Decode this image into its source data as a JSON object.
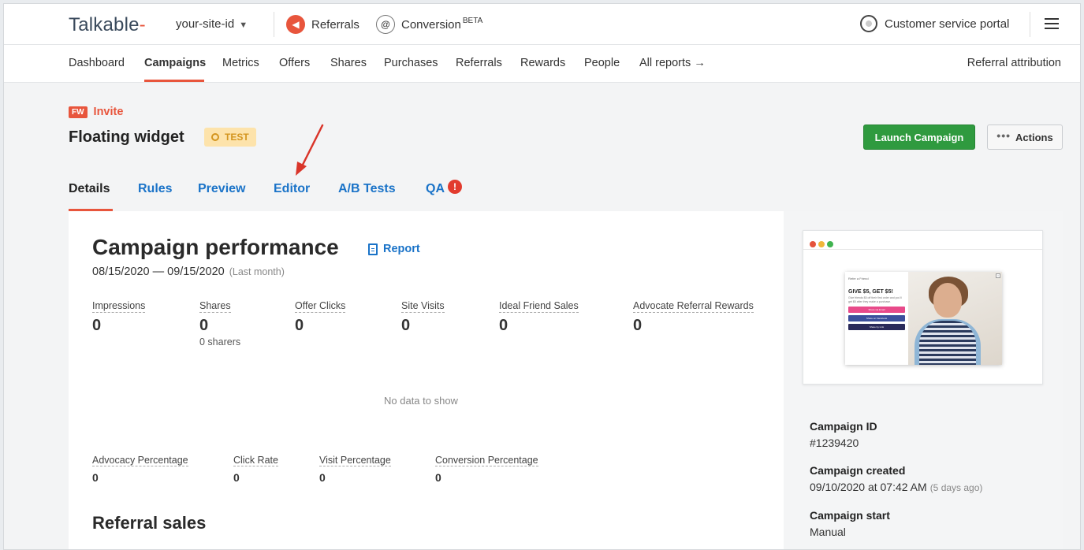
{
  "topbar": {
    "logo": "Talkable",
    "site_id": "your-site-id",
    "products": [
      {
        "label": "Referrals",
        "icon": "megaphone-icon"
      },
      {
        "label": "Conversion",
        "badge": "BETA",
        "icon": "at-sign-icon"
      }
    ],
    "portal": "Customer service portal"
  },
  "nav": {
    "items": [
      "Dashboard",
      "Campaigns",
      "Metrics",
      "Offers",
      "Shares",
      "Purchases",
      "Referrals",
      "Rewards",
      "People",
      "All reports"
    ],
    "active": "Campaigns",
    "right": "Referral attribution"
  },
  "campaign": {
    "type_badge": "FW",
    "type": "Invite",
    "title": "Floating widget",
    "status": "TEST",
    "launch_label": "Launch Campaign",
    "actions_label": "Actions"
  },
  "tabs": {
    "items": [
      "Details",
      "Rules",
      "Preview",
      "Editor",
      "A/B Tests",
      "QA"
    ],
    "active": "Details",
    "qa_alert": "!"
  },
  "performance": {
    "title": "Campaign performance",
    "report_label": "Report",
    "date_range": "08/15/2020 — 09/15/2020",
    "range_label": "(Last month)",
    "metrics": [
      {
        "label": "Impressions",
        "value": "0"
      },
      {
        "label": "Shares",
        "value": "0",
        "sub": "0 sharers"
      },
      {
        "label": "Offer Clicks",
        "value": "0"
      },
      {
        "label": "Site Visits",
        "value": "0"
      },
      {
        "label": "Ideal Friend Sales",
        "value": "0"
      },
      {
        "label": "Advocate Referral Rewards",
        "value": "0"
      }
    ],
    "no_data": "No data to show",
    "rates": [
      {
        "label": "Advocacy Percentage",
        "value": "0"
      },
      {
        "label": "Click Rate",
        "value": "0"
      },
      {
        "label": "Visit Percentage",
        "value": "0"
      },
      {
        "label": "Conversion Percentage",
        "value": "0"
      }
    ],
    "sales_title": "Referral sales"
  },
  "preview_widget": {
    "header": "Refer a Friend",
    "offer": "GIVE $5, GET $5!",
    "desc": "Give friends $5 off their first order and you'll get $5 after they make a purchase.",
    "buttons": [
      {
        "label": "Share via Email",
        "color": "#e84a8a"
      },
      {
        "label": "Share on Facebook",
        "color": "#3b4f9c"
      },
      {
        "label": "Share by Link",
        "color": "#2a2a5a"
      }
    ],
    "window_dots": [
      "#e5533c",
      "#f0b63a",
      "#3fb34f"
    ]
  },
  "info": {
    "campaign_id_label": "Campaign ID",
    "campaign_id": "#1239420",
    "created_label": "Campaign created",
    "created": "09/10/2020 at 07:42 AM",
    "created_ago": "(5 days ago)",
    "start_label": "Campaign start",
    "start": "Manual"
  },
  "colors": {
    "brand": "#e8553c",
    "link": "#1a73c8",
    "launch": "#2f9a3f",
    "test_badge_bg": "#fde3ab"
  }
}
